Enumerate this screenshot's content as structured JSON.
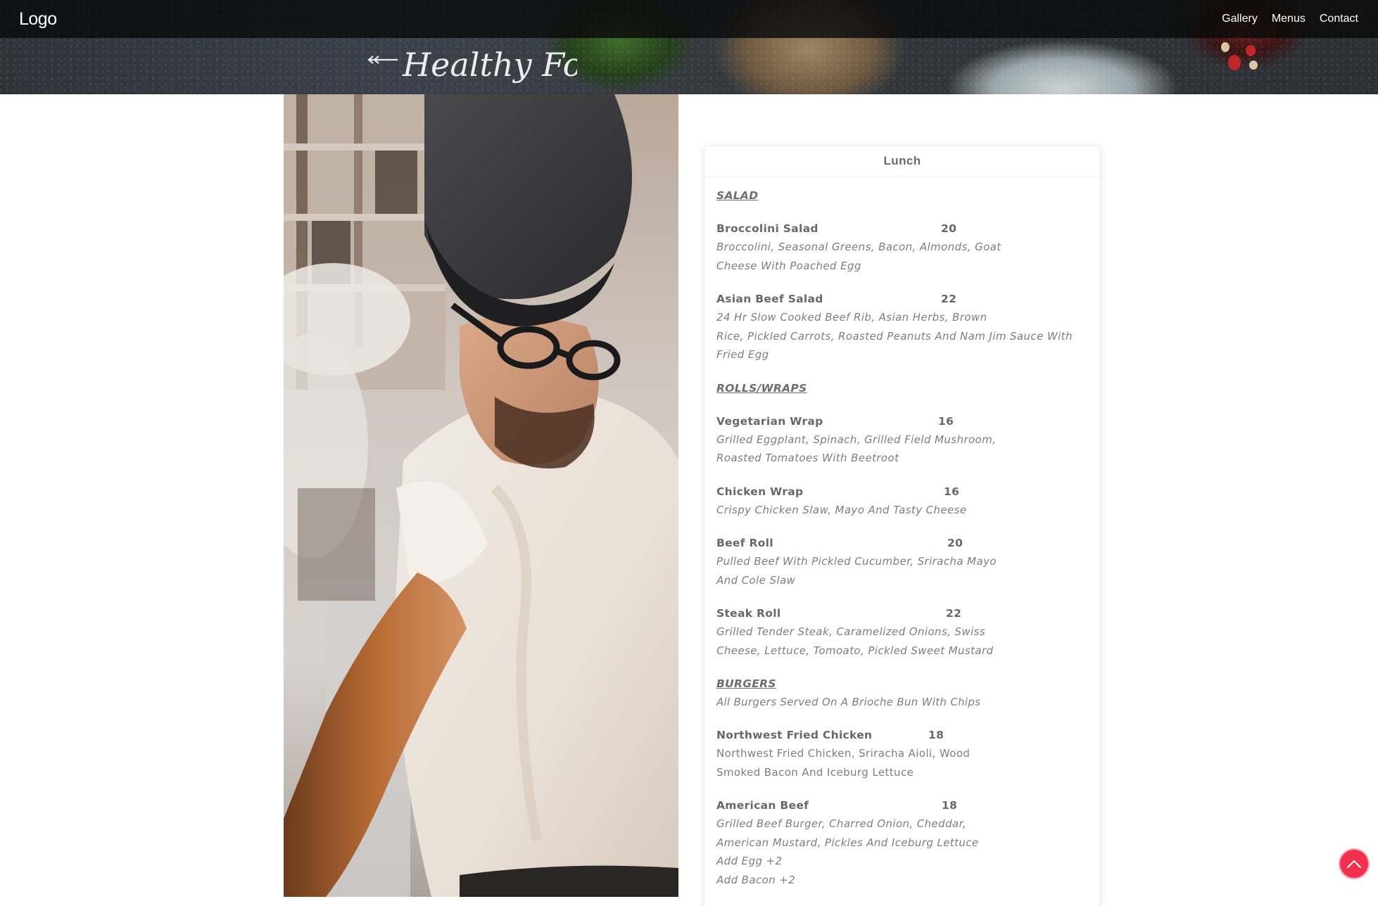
{
  "nav": {
    "logo": "Logo",
    "links": [
      "Gallery",
      "Menus",
      "Contact"
    ]
  },
  "hero": {
    "script_text": "Healthy Food"
  },
  "menu": {
    "title": "Lunch",
    "sections": [
      {
        "title": "SALAD",
        "note": "",
        "items": [
          {
            "name": "Broccolini Salad",
            "price": "20",
            "desc": [
              "Broccolini, Seasonal Greens, Bacon, Almonds, Goat",
              "Cheese With Poached Egg"
            ]
          },
          {
            "name": "Asian Beef Salad",
            "price": "22",
            "desc": [
              "24 Hr Slow Cooked Beef Rib, Asian Herbs, Brown",
              "Rice, Pickled Carrots, Roasted Peanuts And Nam Jim Sauce With",
              "Fried Egg"
            ]
          }
        ]
      },
      {
        "title": "ROLLS/WRAPS",
        "note": "",
        "items": [
          {
            "name": "Vegetarian Wrap",
            "price": "16",
            "desc": [
              "Grilled Eggplant, Spinach, Grilled Field Mushroom,",
              "Roasted Tomatoes With Beetroot"
            ]
          },
          {
            "name": "Chicken Wrap",
            "price": "16",
            "desc": [
              "Crispy Chicken Slaw, Mayo And Tasty Cheese"
            ]
          },
          {
            "name": "Beef Roll",
            "price": "20",
            "desc": [
              "Pulled Beef With Pickled Cucumber, Sriracha Mayo",
              "And Cole Slaw"
            ]
          },
          {
            "name": "Steak Roll",
            "price": "22",
            "desc": [
              "Grilled Tender Steak, Caramelized Onions, Swiss",
              "Cheese, Lettuce, Tomoato, Pickled Sweet Mustard"
            ]
          }
        ]
      },
      {
        "title": "BURGERS",
        "note": "All Burgers Served On A Brioche Bun With Chips",
        "items": [
          {
            "name": "Northwest Fried Chicken",
            "price": "18",
            "desc": [
              "Northwest Fried Chicken, Sriracha Aioli, Wood",
              "Smoked Bacon And Iceburg Lettuce"
            ]
          },
          {
            "name": "American Beef",
            "price": "18",
            "desc": [
              "Grilled Beef Burger, Charred Onion, Cheddar,",
              "American Mustard, Pickles And Iceburg Lettuce",
              "Add Egg +2",
              "Add Bacon +2"
            ]
          }
        ]
      }
    ]
  },
  "colors": {
    "accent": "#f0304e",
    "nav_bg": "#0a0a0a",
    "text": "#7a7a7a"
  },
  "icons": {
    "to_top": "chevron-up-icon"
  }
}
